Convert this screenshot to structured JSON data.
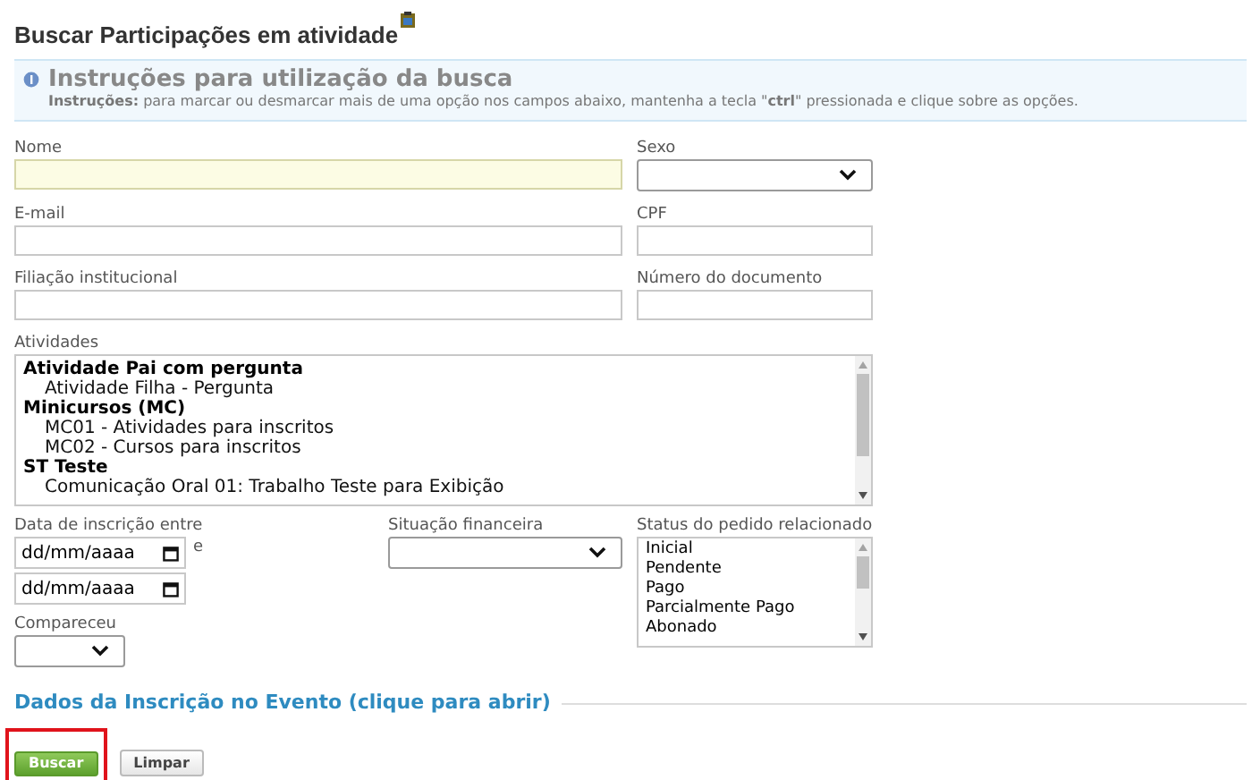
{
  "page_title": "Buscar Participações em atividade",
  "instructions": {
    "title": "Instruções para utilização da busca",
    "text": "**Instruções:** para marcar ou desmarcar mais de uma opção nos campos abaixo, mantenha a tecla \"**ctrl**\" pressionada e clique sobre as opções."
  },
  "fields": [
    {
      "label": "Nome",
      "kind": "text",
      "focused": true
    },
    {
      "label": "Sexo",
      "kind": "select"
    },
    {
      "label": "E-mail",
      "kind": "text",
      "focused": false
    },
    {
      "label": "CPF",
      "kind": "text",
      "focused": false
    },
    {
      "label": "Filiação institucional",
      "kind": "text",
      "focused": false
    },
    {
      "label": "Número do documento",
      "kind": "text",
      "focused": false
    }
  ],
  "atividades": {
    "label": "Atividades",
    "items": [
      {
        "label": "Atividade Pai com pergunta",
        "children": [
          {
            "label": "Atividade Filha - Pergunta"
          }
        ]
      },
      {
        "label": "Minicursos (MC)",
        "children": [
          {
            "label": "MC01 - Atividades para inscritos"
          },
          {
            "label": "MC02 - Cursos para inscritos"
          }
        ]
      },
      {
        "label": "ST Teste",
        "children": [
          {
            "label": "Comunicação Oral 01: Trabalho Teste para Exibição"
          }
        ]
      }
    ]
  },
  "data_inscricao": {
    "label": "Data de inscrição entre",
    "separator": "e",
    "placeholders": [
      "dd/mm/aaaa",
      "dd/mm/aaaa"
    ]
  },
  "situacao_financeira": {
    "label": "Situação financeira"
  },
  "status_pedido": {
    "label": "Status do pedido relacionado",
    "options": [
      "Inicial",
      "Pendente",
      "Pago",
      "Parcialmente Pago",
      "Abonado"
    ]
  },
  "compareceu": {
    "label": "Compareceu"
  },
  "section": {
    "title": "Dados da Inscrição no Evento (clique para abrir)"
  },
  "buttons": [
    {
      "label": "Buscar",
      "kind": "primary",
      "highlighted": true
    },
    {
      "label": "Limpar",
      "kind": "secondary",
      "highlighted": false
    }
  ]
}
